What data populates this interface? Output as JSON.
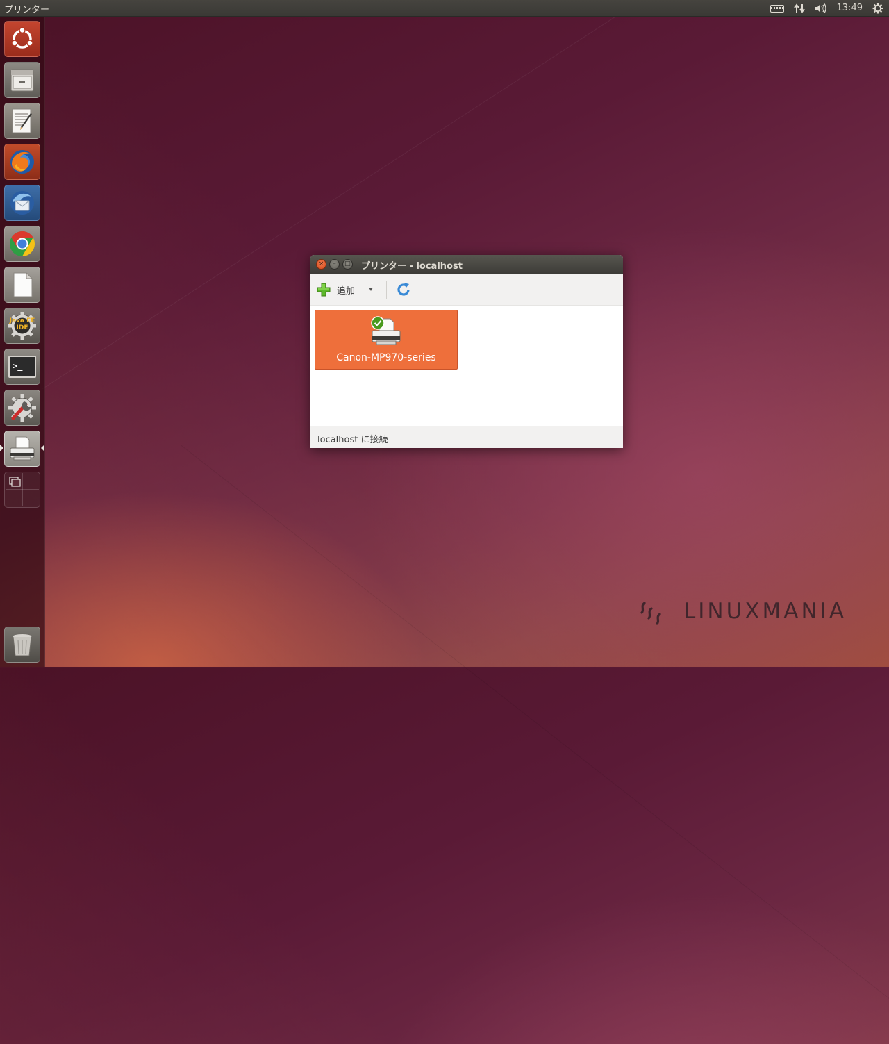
{
  "top_panel": {
    "app_title": "プリンター",
    "clock": "13:49",
    "indicators": [
      "keyboard-icon",
      "network-icon",
      "volume-icon",
      "settings-gear-icon"
    ]
  },
  "launcher": {
    "items": [
      {
        "name": "ubuntu-dash",
        "icon": "ubuntu-logo-icon"
      },
      {
        "name": "files",
        "icon": "file-cabinet-icon"
      },
      {
        "name": "text-editor",
        "icon": "text-editor-icon"
      },
      {
        "name": "firefox",
        "icon": "firefox-icon"
      },
      {
        "name": "thunderbird",
        "icon": "thunderbird-icon"
      },
      {
        "name": "chrome",
        "icon": "chrome-icon"
      },
      {
        "name": "libreoffice",
        "icon": "document-icon"
      },
      {
        "name": "java-ee-ide",
        "icon": "java-ee-ide-icon",
        "label": "Java EE IDE"
      },
      {
        "name": "terminal",
        "icon": "terminal-icon"
      },
      {
        "name": "system-tools",
        "icon": "wrench-screwdriver-icon"
      },
      {
        "name": "printers",
        "icon": "printer-icon",
        "active": true
      },
      {
        "name": "workspace-switcher",
        "icon": "workspace-switcher-icon"
      },
      {
        "name": "trash",
        "icon": "trash-icon"
      }
    ],
    "java_label_line1": "Java EE",
    "java_label_line2": "IDE",
    "terminal_prompt": ">_"
  },
  "window": {
    "title": "プリンター - localhost",
    "close_glyph": "×",
    "min_glyph": "–",
    "max_glyph": "□",
    "toolbar": {
      "add_label": "追加",
      "add_icon": "green-plus-icon",
      "refresh_icon": "refresh-icon"
    },
    "printers": [
      {
        "name": "Canon-MP970-series",
        "status_icon": "default-check-icon",
        "selected": true
      }
    ],
    "status": "localhost に接続"
  },
  "watermark": {
    "text": "LINUXMANIA"
  },
  "colors": {
    "selection": "#ee6f3b",
    "panel": "#3c3b37",
    "close_button": "#e45b2d",
    "plus_green": "#4ca218",
    "refresh_blue": "#3a8ad6"
  }
}
